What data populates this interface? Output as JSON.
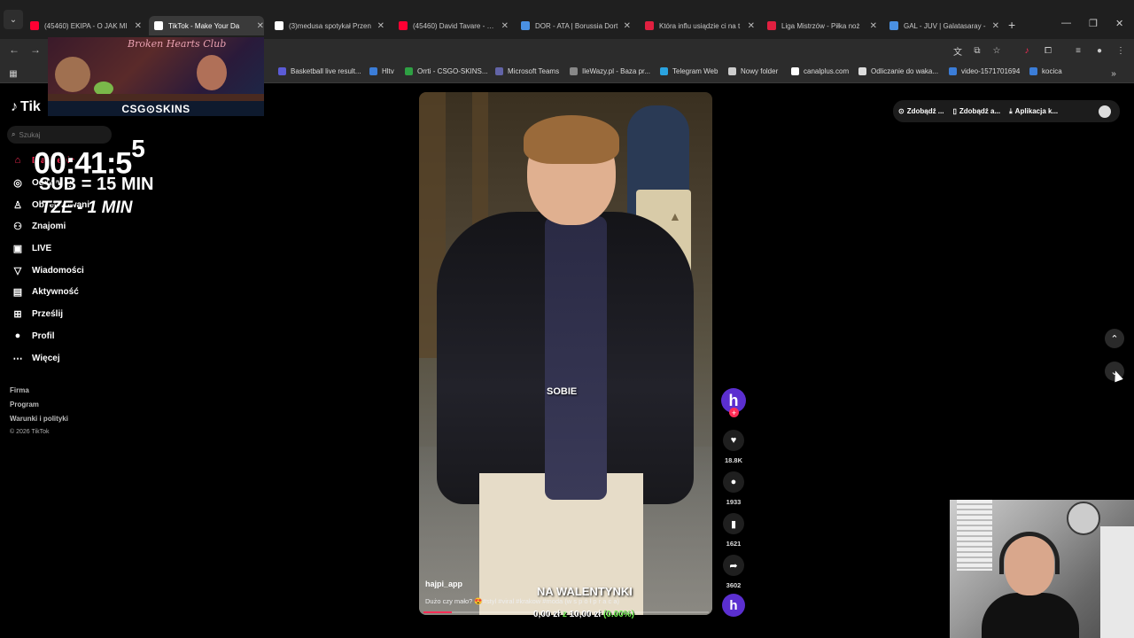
{
  "tabs": [
    {
      "label": "(45460) EKIPA - O JAK MI",
      "color": "#ff0033",
      "active": false
    },
    {
      "label": "TikTok - Make Your Da",
      "color": "#ffffff",
      "active": true
    },
    {
      "label": "(3)medusa spotykał Przen",
      "color": "#ffffff",
      "active": false
    },
    {
      "label": "(45460) David Tavare - Ca",
      "color": "#ff0033",
      "active": false
    },
    {
      "label": "DOR - ATA | Borussia Dort",
      "color": "#4a90e2",
      "active": false
    },
    {
      "label": "Która influ usiądzie ci na t",
      "color": "#e02040",
      "active": false
    },
    {
      "label": "Liga Mistrzów - Piłka noż",
      "color": "#e02040",
      "active": false
    },
    {
      "label": "GAL - JUV | Galatasaray -",
      "color": "#4a90e2",
      "active": false
    }
  ],
  "bookmarks": [
    {
      "label": "Basketball live result...",
      "color": "#5b5bd6"
    },
    {
      "label": "Hltv",
      "color": "#3b7dd8"
    },
    {
      "label": "Orrti - CSGO-SKINS...",
      "color": "#2ea043"
    },
    {
      "label": "Microsoft Teams",
      "color": "#6264a7"
    },
    {
      "label": "IleWazy.pl - Baza pr...",
      "color": "#888888"
    },
    {
      "label": "Telegram Web",
      "color": "#2aa3e0"
    },
    {
      "label": "Nowy folder",
      "color": "#cccccc"
    },
    {
      "label": "canalplus.com",
      "color": "#ffffff"
    },
    {
      "label": "Odliczanie do waka...",
      "color": "#dddddd"
    },
    {
      "label": "video-1571701694",
      "color": "#3b7dd8"
    },
    {
      "label": "kocica",
      "color": "#3b7dd8"
    }
  ],
  "sidebar": {
    "logo": "Tik",
    "search_placeholder": "Szukaj",
    "items": [
      {
        "label": "Dla Ciebie"
      },
      {
        "label": "Odkrywaj"
      },
      {
        "label": "Obserwowani"
      },
      {
        "label": "Znajomi"
      },
      {
        "label": "LIVE"
      },
      {
        "label": "Wiadomości"
      },
      {
        "label": "Aktywność"
      },
      {
        "label": "Prześlij"
      },
      {
        "label": "Profil"
      },
      {
        "label": "Więcej"
      }
    ],
    "footer": [
      "Firma",
      "Program",
      "Warunki i polityki"
    ],
    "copyright": "© 2026 TikTok"
  },
  "overlay": {
    "banner_title": "Broken Hearts Club",
    "banner_sponsor": "CSG⊙SKINS",
    "timer_main": "00:41:5",
    "timer_sup": "5",
    "line1": "SUB = 15 MIN",
    "line2": "TZE - 1 MIN"
  },
  "video": {
    "caption_center": "SOBIE",
    "author": "hajpi_app",
    "description": "Dużo czy mało? 😍#styl #viral #krakow #moda (w s p ó ł p r a c a)",
    "big_caption": "NA WALENTYNKI",
    "money_a": "0,00 zł",
    "money_z": "z",
    "money_b": "10,00 zł",
    "money_pct": "(0.00%)",
    "progress": 0.1
  },
  "actions": {
    "avatar_letter": "h",
    "likes": "18.8K",
    "comments": "1933",
    "saves": "1621",
    "shares": "3602"
  },
  "top_right": {
    "pill1": "Zdobądź ...",
    "pill2": "Zdobądź a...",
    "pill3": "Aplikacja k..."
  }
}
